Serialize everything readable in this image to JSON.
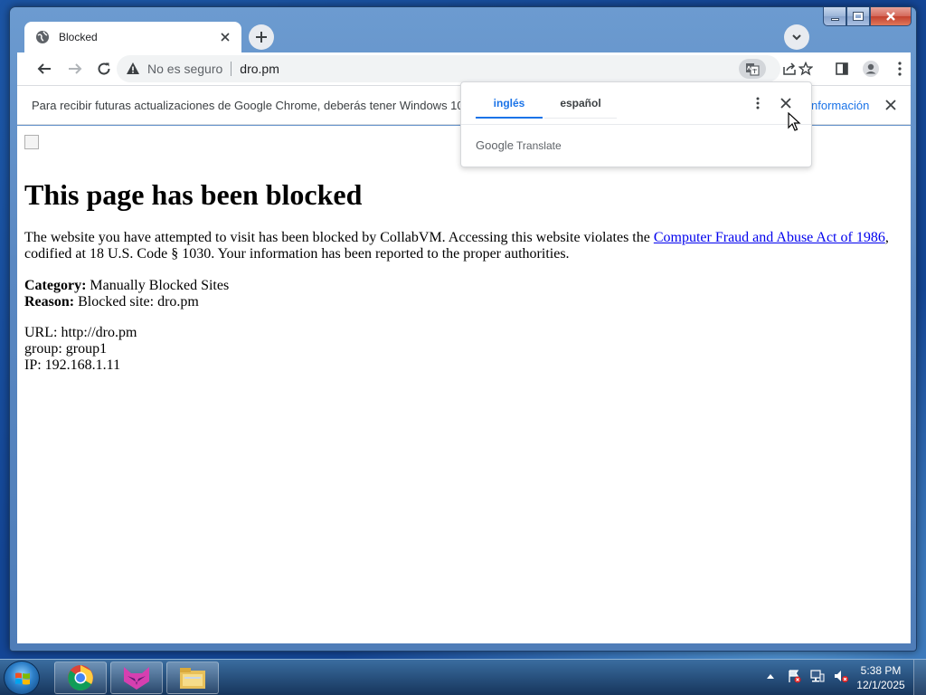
{
  "tab": {
    "title": "Blocked"
  },
  "omnibox": {
    "security_label": "No es seguro",
    "url": "dro.pm"
  },
  "infobar": {
    "message": "Para recibir futuras actualizaciones de Google Chrome, deberás tener Windows 10 o",
    "link": "nformación"
  },
  "translate": {
    "source_language": "inglés",
    "target_language": "español",
    "brand_google": "Google",
    "brand_translate": "Translate"
  },
  "page": {
    "heading": "This page has been blocked",
    "para_before_link": "The website you have attempted to visit has been blocked by CollabVM. Accessing this website violates the ",
    "link_text": "Computer Fraud and Abuse Act of 1986",
    "para_after_link": ", codified at 18 U.S. Code § 1030. Your information has been reported to the proper authorities.",
    "category_label": "Category:",
    "category_value": " Manually Blocked Sites",
    "reason_label": "Reason:",
    "reason_value": " Blocked site: dro.pm",
    "url_line": "URL: http://dro.pm",
    "group_line": "group: group1",
    "ip_line": "IP: 192.168.1.11"
  },
  "taskbar": {
    "apps": [
      "chrome-icon",
      "collabvm-cat-icon",
      "file-explorer-icon"
    ],
    "time": "5:38 PM",
    "date": "12/1/2025"
  },
  "colors": {
    "link_blue": "#0000ee",
    "chrome_accent": "#1a73e8",
    "window_frame": "#5a88c2",
    "taskbar": "#1f4a7a"
  }
}
